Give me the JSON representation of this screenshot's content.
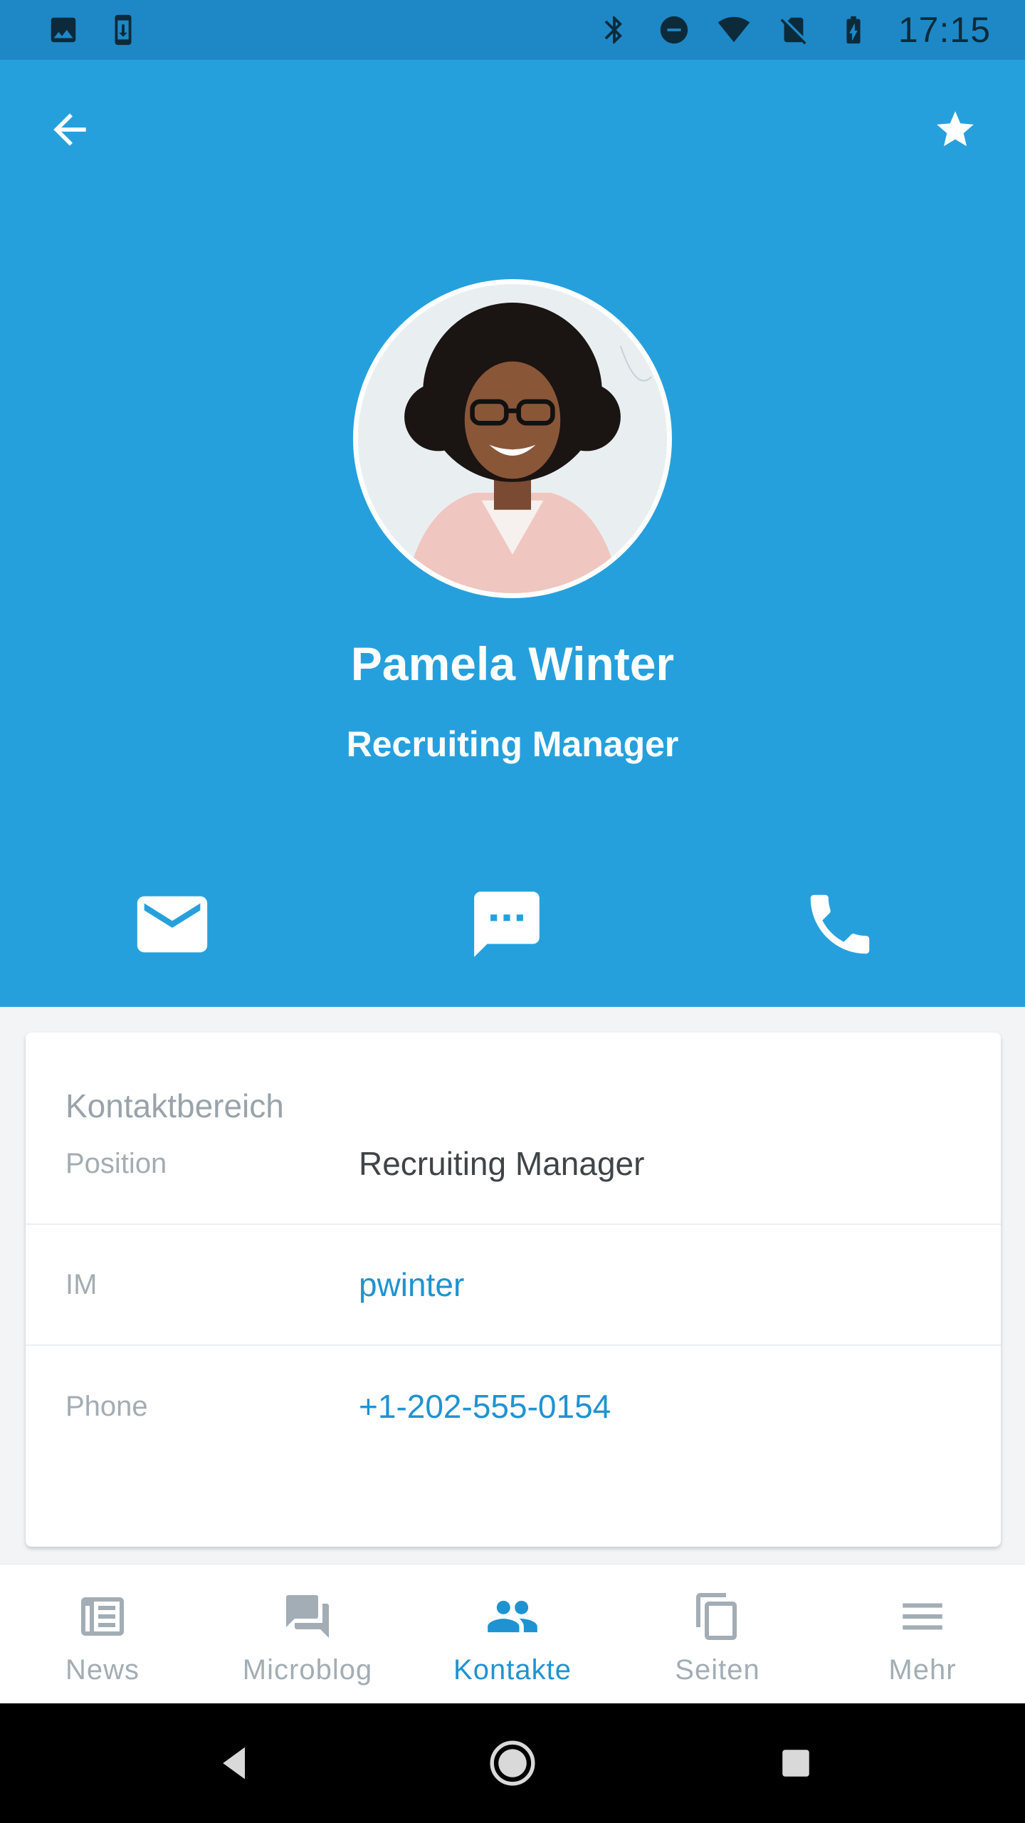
{
  "status_bar": {
    "time": "17:15",
    "left_icons": [
      "image-icon",
      "download-icon"
    ],
    "right_icons": [
      "bluetooth-icon",
      "do-not-disturb-icon",
      "wifi-icon",
      "no-sim-icon",
      "battery-charging-icon"
    ]
  },
  "header": {
    "back_icon": "arrow-back-icon",
    "favorite_icon": "star-icon",
    "name": "Pamela Winter",
    "title": "Recruiting Manager",
    "actions": [
      "mail-icon",
      "chat-icon",
      "phone-icon"
    ]
  },
  "contact": {
    "section_title": "Kontaktbereich",
    "rows": [
      {
        "label": "Position",
        "value": "Recruiting Manager",
        "is_link": false
      },
      {
        "label": "IM",
        "value": "pwinter",
        "is_link": true
      },
      {
        "label": "Phone",
        "value": "+1-202-555-0154",
        "is_link": true
      }
    ]
  },
  "bottom_nav": {
    "tabs": [
      {
        "label": "News",
        "icon": "newspaper-icon",
        "active": false
      },
      {
        "label": "Microblog",
        "icon": "forum-icon",
        "active": false
      },
      {
        "label": "Kontakte",
        "icon": "contacts-icon",
        "active": true
      },
      {
        "label": "Seiten",
        "icon": "pages-icon",
        "active": false
      },
      {
        "label": "Mehr",
        "icon": "menu-icon",
        "active": false
      }
    ]
  },
  "colors": {
    "header_bg": "#26a0dc",
    "status_bar_bg": "#1e88c6",
    "accent": "#1f93d1",
    "inactive": "#a3adb5"
  }
}
